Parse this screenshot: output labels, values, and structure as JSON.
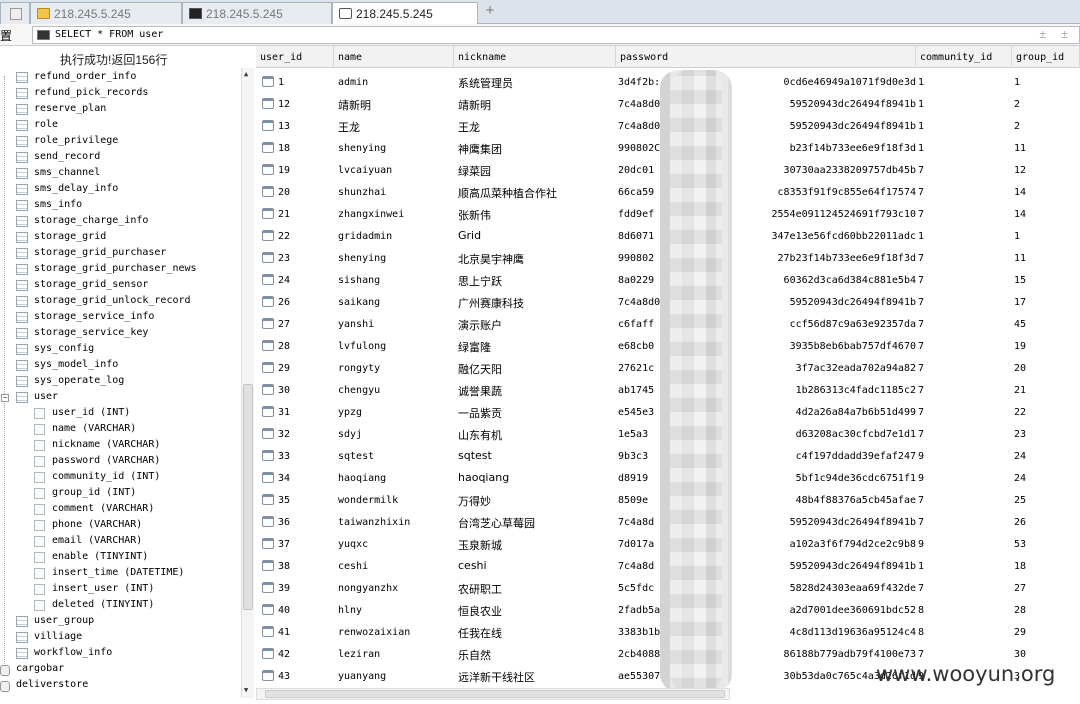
{
  "tabs": [
    {
      "label": "218.245.5.245",
      "icon": "folder-icon"
    },
    {
      "label": "218.245.5.245",
      "icon": "terminal-icon"
    },
    {
      "label": "218.245.5.245",
      "icon": "document-icon"
    }
  ],
  "toolbar": {
    "left_label": "置",
    "sql": "SELECT * FROM user",
    "right_icons": "± ±"
  },
  "status": "执行成功!返回156行",
  "tree": {
    "tables_before": [
      "refund_order_info",
      "refund_pick_records",
      "reserve_plan",
      "role",
      "role_privilege",
      "send_record",
      "sms_channel",
      "sms_delay_info",
      "sms_info",
      "storage_charge_info",
      "storage_grid",
      "storage_grid_purchaser",
      "storage_grid_purchaser_news",
      "storage_grid_sensor",
      "storage_grid_unlock_record",
      "storage_service_info",
      "storage_service_key",
      "sys_config",
      "sys_model_info",
      "sys_operate_log"
    ],
    "expanded_table": "user",
    "expander_minus": "−",
    "expander_plus": "+",
    "columns": [
      "user_id (INT)",
      "name (VARCHAR)",
      "nickname (VARCHAR)",
      "password (VARCHAR)",
      "community_id (INT)",
      "group_id (INT)",
      "comment (VARCHAR)",
      "phone (VARCHAR)",
      "email (VARCHAR)",
      "enable (TINYINT)",
      "insert_time (DATETIME)",
      "insert_user (INT)",
      "deleted (TINYINT)"
    ],
    "tables_after": [
      "user_group",
      "villiage",
      "workflow_info"
    ],
    "databases": [
      "cargobar",
      "deliverstore"
    ]
  },
  "grid": {
    "headers": [
      "user_id",
      "name",
      "nickname",
      "password",
      "community_id",
      "group_id"
    ],
    "rows": [
      {
        "id": "1",
        "name": "admin",
        "nick": "系统管理员",
        "pw_a": "3d4f2b:",
        "pw_b": "0cd6e46949a1071f9d0e3d",
        "cid": "1",
        "gid": "1"
      },
      {
        "id": "12",
        "name": "靖新明",
        "nick": "靖新明",
        "pw_a": "7c4a8d0",
        "pw_b": "59520943dc26494f8941b",
        "cid": "1",
        "gid": "2"
      },
      {
        "id": "13",
        "name": "王龙",
        "nick": "王龙",
        "pw_a": "7c4a8d0",
        "pw_b": "59520943dc26494f8941b",
        "cid": "1",
        "gid": "2"
      },
      {
        "id": "18",
        "name": "shenying",
        "nick": "神鹰集团",
        "pw_a": "990802C",
        "pw_b": "b23f14b733ee6e9f18f3d",
        "cid": "1",
        "gid": "11"
      },
      {
        "id": "19",
        "name": "lvcaiyuan",
        "nick": "绿菜园",
        "pw_a": "20dc01",
        "pw_b": "30730aa2338209757db45b",
        "cid": "7",
        "gid": "12"
      },
      {
        "id": "20",
        "name": "shunzhai",
        "nick": "顺高瓜菜种植合作社",
        "pw_a": "66ca59",
        "pw_b": "c8353f91f9c855e64f17574",
        "cid": "7",
        "gid": "14"
      },
      {
        "id": "21",
        "name": "zhangxinwei",
        "nick": "张新伟",
        "pw_a": "fdd9ef",
        "pw_b": "2554e091124524691f793c10",
        "cid": "7",
        "gid": "14"
      },
      {
        "id": "22",
        "name": "gridadmin",
        "nick": "Grid",
        "pw_a": "8d6071",
        "pw_b": "347e13e56fcd60bb22011adc",
        "cid": "1",
        "gid": "1"
      },
      {
        "id": "23",
        "name": "shenying",
        "nick": "北京昊宇神鹰",
        "pw_a": "990802",
        "pw_b": "27b23f14b733ee6e9f18f3d",
        "cid": "7",
        "gid": "11"
      },
      {
        "id": "24",
        "name": "sishang",
        "nick": "思上宁跃",
        "pw_a": "8a0229",
        "pw_b": "60362d3ca6d384c881e5b4",
        "cid": "7",
        "gid": "15"
      },
      {
        "id": "26",
        "name": "saikang",
        "nick": "广州赛康科技",
        "pw_a": "7c4a8d0",
        "pw_b": "59520943dc26494f8941b",
        "cid": "7",
        "gid": "17"
      },
      {
        "id": "27",
        "name": "yanshi",
        "nick": "演示账户",
        "pw_a": "c6faff",
        "pw_b": "ccf56d87c9a63e92357da",
        "cid": "7",
        "gid": "45"
      },
      {
        "id": "28",
        "name": "lvfulong",
        "nick": "绿富隆",
        "pw_a": "e68cb0",
        "pw_b": "3935b8eb6bab757df4670",
        "cid": "7",
        "gid": "19"
      },
      {
        "id": "29",
        "name": "rongyty",
        "nick": "融亿天阳",
        "pw_a": "27621c",
        "pw_b": "3f7ac32eada702a94a82",
        "cid": "7",
        "gid": "20"
      },
      {
        "id": "30",
        "name": "chengyu",
        "nick": "诚誉果蔬",
        "pw_a": "ab1745",
        "pw_b": "1b286313c4fadc1185c2",
        "cid": "7",
        "gid": "21"
      },
      {
        "id": "31",
        "name": "ypzg",
        "nick": "一品紫贡",
        "pw_a": "e545e3",
        "pw_b": "4d2a26a84a7b6b51d499",
        "cid": "7",
        "gid": "22"
      },
      {
        "id": "32",
        "name": "sdyj",
        "nick": "山东有机",
        "pw_a": "1e5a3",
        "pw_b": "d63208ac30cfcbd7e1d1",
        "cid": "7",
        "gid": "23"
      },
      {
        "id": "33",
        "name": "sqtest",
        "nick": "sqtest",
        "pw_a": "9b3c3",
        "pw_b": "c4f197ddadd39efaf247",
        "cid": "9",
        "gid": "24"
      },
      {
        "id": "34",
        "name": "haoqiang",
        "nick": "haoqiang",
        "pw_a": "d8919",
        "pw_b": "5bf1c94de36cdc6751f1",
        "cid": "9",
        "gid": "24"
      },
      {
        "id": "35",
        "name": "wondermilk",
        "nick": "万得妙",
        "pw_a": "8509e",
        "pw_b": "48b4f88376a5cb45afae",
        "cid": "7",
        "gid": "25"
      },
      {
        "id": "36",
        "name": "taiwanzhixin",
        "nick": "台湾芝心草莓园",
        "pw_a": "7c4a8d",
        "pw_b": "59520943dc26494f8941b",
        "cid": "7",
        "gid": "26"
      },
      {
        "id": "37",
        "name": "yuqxc",
        "nick": "玉泉新城",
        "pw_a": "7d017a",
        "pw_b": "a102a3f6f794d2ce2c9b8",
        "cid": "9",
        "gid": "53"
      },
      {
        "id": "38",
        "name": "ceshi",
        "nick": "ceshi",
        "pw_a": "7c4a8d",
        "pw_b": "59520943dc26494f8941b",
        "cid": "1",
        "gid": "18"
      },
      {
        "id": "39",
        "name": "nongyanzhx",
        "nick": "农研职工",
        "pw_a": "5c5fdc",
        "pw_b": "5828d24303eaa69f432de",
        "cid": "7",
        "gid": "27"
      },
      {
        "id": "40",
        "name": "hlny",
        "nick": "恒良农业",
        "pw_a": "2fadb5a",
        "pw_b": "a2d7001dee360691bdc52",
        "cid": "8",
        "gid": "28"
      },
      {
        "id": "41",
        "name": "renwozaixian",
        "nick": "任我在线",
        "pw_a": "3383b1b",
        "pw_b": "4c8d113d19636a95124c4",
        "cid": "8",
        "gid": "29"
      },
      {
        "id": "42",
        "name": "leziran",
        "nick": "乐自然",
        "pw_a": "2cb4088",
        "pw_b": "86188b779adb79f4100e73",
        "cid": "7",
        "gid": "30"
      },
      {
        "id": "43",
        "name": "yuanyang",
        "nick": "远洋新干线社区",
        "pw_a": "ae55307",
        "pw_b": "30b53da0c765c4a3d26f1d",
        "cid": "9",
        "gid": "3"
      }
    ]
  },
  "watermark": "www.wooyun.org"
}
